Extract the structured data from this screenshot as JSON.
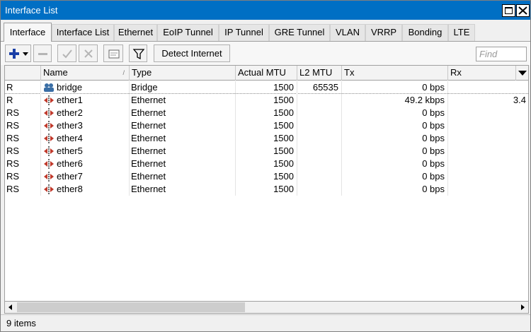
{
  "window": {
    "title": "Interface List"
  },
  "tabs": [
    {
      "label": "Interface",
      "active": true
    },
    {
      "label": "Interface List",
      "active": false
    },
    {
      "label": "Ethernet",
      "active": false
    },
    {
      "label": "EoIP Tunnel",
      "active": false
    },
    {
      "label": "IP Tunnel",
      "active": false
    },
    {
      "label": "GRE Tunnel",
      "active": false
    },
    {
      "label": "VLAN",
      "active": false
    },
    {
      "label": "VRRP",
      "active": false
    },
    {
      "label": "Bonding",
      "active": false
    },
    {
      "label": "LTE",
      "active": false
    }
  ],
  "toolbar": {
    "icons": [
      "add-icon",
      "remove-icon",
      "enable-icon",
      "disable-icon",
      "comment-icon",
      "filter-icon"
    ],
    "detect_label": "Detect Internet",
    "find_placeholder": "Find"
  },
  "columns": [
    "",
    "Name",
    "Type",
    "Actual MTU",
    "L2 MTU",
    "Tx",
    "Rx"
  ],
  "rows": [
    {
      "flags": "R",
      "name": "bridge",
      "icon": "bridge-icon",
      "type": "Bridge",
      "mtu": "1500",
      "l2mtu": "65535",
      "tx": "0 bps",
      "rx": ""
    },
    {
      "flags": "R",
      "name": "ether1",
      "icon": "ethernet-icon",
      "type": "Ethernet",
      "mtu": "1500",
      "l2mtu": "",
      "tx": "49.2 kbps",
      "rx": "3.4"
    },
    {
      "flags": "RS",
      "name": "ether2",
      "icon": "ethernet-icon",
      "type": "Ethernet",
      "mtu": "1500",
      "l2mtu": "",
      "tx": "0 bps",
      "rx": ""
    },
    {
      "flags": "RS",
      "name": "ether3",
      "icon": "ethernet-icon",
      "type": "Ethernet",
      "mtu": "1500",
      "l2mtu": "",
      "tx": "0 bps",
      "rx": ""
    },
    {
      "flags": "RS",
      "name": "ether4",
      "icon": "ethernet-icon",
      "type": "Ethernet",
      "mtu": "1500",
      "l2mtu": "",
      "tx": "0 bps",
      "rx": ""
    },
    {
      "flags": "RS",
      "name": "ether5",
      "icon": "ethernet-icon",
      "type": "Ethernet",
      "mtu": "1500",
      "l2mtu": "",
      "tx": "0 bps",
      "rx": ""
    },
    {
      "flags": "RS",
      "name": "ether6",
      "icon": "ethernet-icon",
      "type": "Ethernet",
      "mtu": "1500",
      "l2mtu": "",
      "tx": "0 bps",
      "rx": ""
    },
    {
      "flags": "RS",
      "name": "ether7",
      "icon": "ethernet-icon",
      "type": "Ethernet",
      "mtu": "1500",
      "l2mtu": "",
      "tx": "0 bps",
      "rx": ""
    },
    {
      "flags": "RS",
      "name": "ether8",
      "icon": "ethernet-icon",
      "type": "Ethernet",
      "mtu": "1500",
      "l2mtu": "",
      "tx": "0 bps",
      "rx": ""
    }
  ],
  "status": {
    "items_label": "9 items"
  },
  "colors": {
    "titlebar": "#006fc4",
    "add": "#1a3fa6",
    "ethernet_icon": "#c0392b",
    "bridge_icon": "#3a6ea5"
  }
}
